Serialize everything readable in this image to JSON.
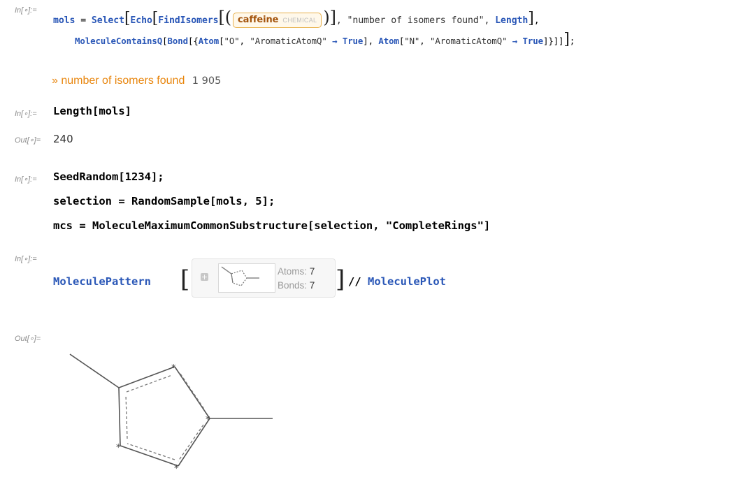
{
  "cells": {
    "in1_label": "In[∘]:=",
    "in1": {
      "var": "mols",
      "eq": " = ",
      "select": "Select",
      "echo": "Echo",
      "findisomers": "FindIsomers",
      "entity_name": "caffeine",
      "entity_type": "CHEMICAL",
      "echo_label": ", \"number of isomers found\", ",
      "length": "Length",
      "mcq": "MoleculeContainsQ",
      "bond": "Bond",
      "atom": "Atom",
      "atom_o": "\"O\"",
      "aromatic": "\"AromaticAtomQ\"",
      "arrow_true": " → True",
      "atom_n": "\"N\"",
      "true_kw": "True"
    },
    "echo_output": {
      "marker": "»",
      "label": "number of isomers found",
      "value": "1 905"
    },
    "in2_label": "In[∘]:=",
    "in2": "Length[mols]",
    "out2_label": "Out[∘]=",
    "out2": "240",
    "in3_label": "In[∘]:=",
    "in3": {
      "line1": "SeedRandom[1234];",
      "line2": "selection = RandomSample[mols, 5];",
      "line3": "mcs = MoleculeMaximumCommonSubstructure[selection, \"CompleteRings\"]"
    },
    "in4_label": "In[∘]:=",
    "in4": {
      "func": "MoleculePattern",
      "summary_atoms_label": "Atoms:",
      "summary_atoms": "7",
      "summary_bonds_label": "Bonds:",
      "summary_bonds": "7",
      "postfix": "// ",
      "plot": "MoleculePlot"
    },
    "out4_label": "Out[∘]=",
    "plot_wildcard": "*"
  }
}
